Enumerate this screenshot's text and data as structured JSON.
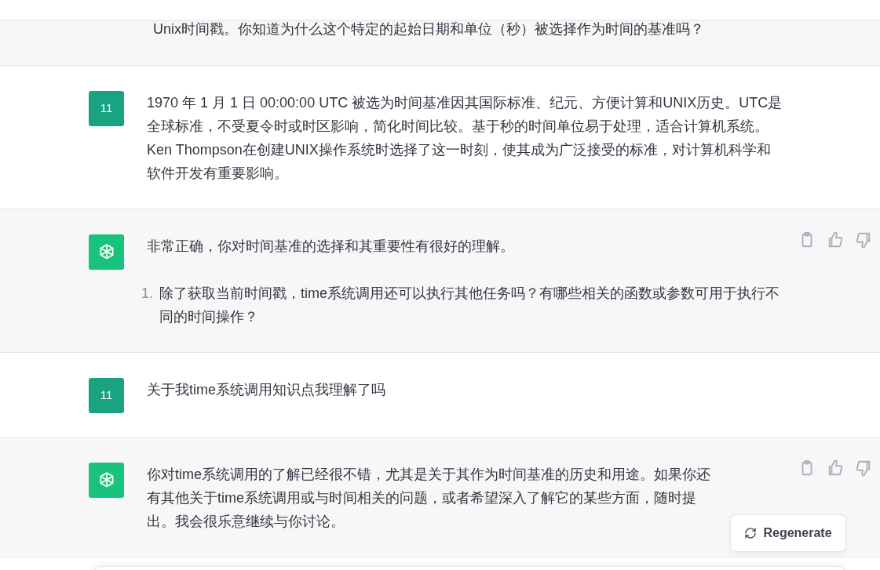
{
  "messages": [
    {
      "kind": "fragment",
      "paragraphs": [
        "Unix时间戳。你知道为什么这个特定的起始日期和单位（秒）被选择作为时间的基准吗？"
      ]
    },
    {
      "kind": "user",
      "avatar": "11",
      "paragraphs": [
        "1970 年 1 月 1 日 00:00:00 UTC 被选为时间基准因其国际标准、纪元、方便计算和UNIX历史。UTC是全球标准，不受夏令时或时区影响，简化时间比较。基于秒的时间单位易于处理，适合计算机系统。Ken Thompson在创建UNIX操作系统时选择了这一时刻，使其成为广泛接受的标准，对计算机科学和软件开发有重要影响。"
      ]
    },
    {
      "kind": "assistant",
      "paragraphs": [
        "非常正确，你对时间基准的选择和其重要性有很好的理解。"
      ],
      "list": [
        {
          "marker": "1.",
          "text": "除了获取当前时间戳，time系统调用还可以执行其他任务吗？有哪些相关的函数或参数可用于执行不同的时间操作？"
        }
      ],
      "feedback": true
    },
    {
      "kind": "user",
      "avatar": "11",
      "paragraphs": [
        "关于我time系统调用知识点我理解了吗"
      ]
    },
    {
      "kind": "assistant",
      "paragraphs": [
        "你对time系统调用的了解已经很不错，尤其是关于其作为时间基准的历史和用途。如果你还有其他关于time系统调用或与时间相关的问题，或者希望深入了解它的某些方面，随时提出。我会很乐意继续与你讨论。"
      ],
      "feedback": true
    }
  ],
  "regenerate": {
    "label": "Regenerate"
  }
}
